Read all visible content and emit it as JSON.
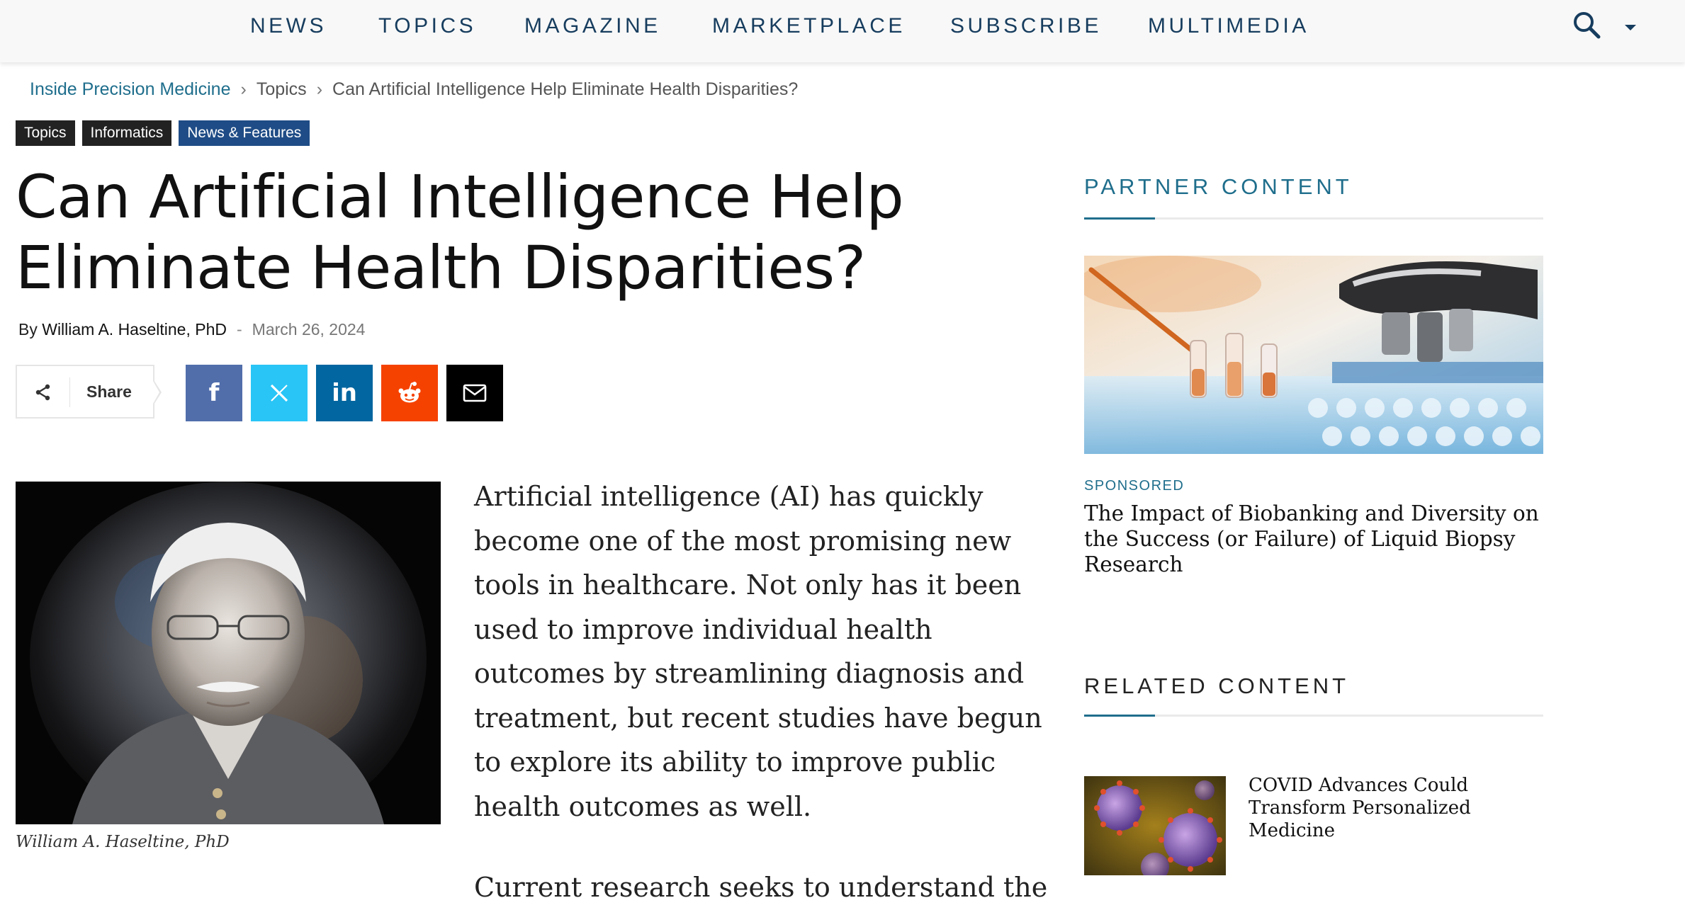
{
  "nav": {
    "items": [
      {
        "label": "NEWS"
      },
      {
        "label": "TOPICS"
      },
      {
        "label": "MAGAZINE"
      },
      {
        "label": "MARKETPLACE"
      },
      {
        "label": "SUBSCRIBE"
      },
      {
        "label": "MULTIMEDIA"
      }
    ],
    "search_icon": "search-icon",
    "menu_caret_icon": "caret-down-icon"
  },
  "breadcrumb": {
    "home": "Inside Precision Medicine",
    "section": "Topics",
    "current": "Can Artificial Intelligence Help Eliminate Health Disparities?",
    "separator": "›"
  },
  "tags": [
    {
      "label": "Topics"
    },
    {
      "label": "Informatics"
    },
    {
      "label": "News & Features"
    }
  ],
  "article": {
    "title": "Can Artificial Intelligence Help Eliminate Health Disparities?",
    "by_prefix": "By",
    "author": "William A. Haseltine, PhD",
    "dash": "-",
    "date": "March 26, 2024",
    "image_caption": "William A. Haseltine, PhD",
    "paragraph1": "Artificial intelligence (AI) has quickly become one of the most promising new tools in healthcare. Not only has it been used to improve individual health outcomes by streamlining diagnosis and treatment, but recent studies have begun to explore its ability to improve public health outcomes as well.",
    "paragraph2_partial": "Current research seeks to understand the"
  },
  "share": {
    "label": "Share",
    "buttons": [
      {
        "icon": "facebook-icon",
        "glyph": "f",
        "color": "#516eab"
      },
      {
        "icon": "x-twitter-icon",
        "glyph": "𝕏",
        "color": "#29c5f6"
      },
      {
        "icon": "linkedin-icon",
        "glyph": "in",
        "color": "#0266a0"
      },
      {
        "icon": "reddit-icon",
        "glyph": "",
        "color": "#f54200"
      },
      {
        "icon": "email-icon",
        "glyph": "",
        "color": "#000000"
      }
    ]
  },
  "sidebar": {
    "partner_heading": "PARTNER CONTENT",
    "sponsored_label": "SPONSORED",
    "partner_title": "The Impact of Biobanking and Diversity on the Success (or Failure) of Liquid Biopsy Research",
    "related_heading": "RELATED CONTENT",
    "related_items": [
      {
        "title": "COVID Advances Could Transform Personalized Medicine"
      }
    ]
  },
  "colors": {
    "brand_teal": "#1f6e8c",
    "nav_text": "#173d5e",
    "tag_dark": "#222222",
    "tag_blue": "#1f4c86"
  }
}
